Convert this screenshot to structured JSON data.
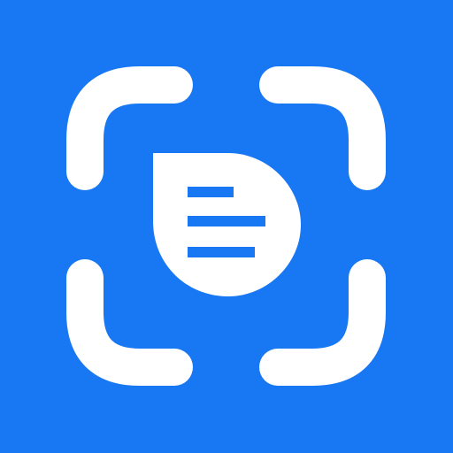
{
  "icon": {
    "name": "document-scan-icon",
    "background_color": "#1877F2",
    "foreground_color": "#FFFFFF"
  }
}
